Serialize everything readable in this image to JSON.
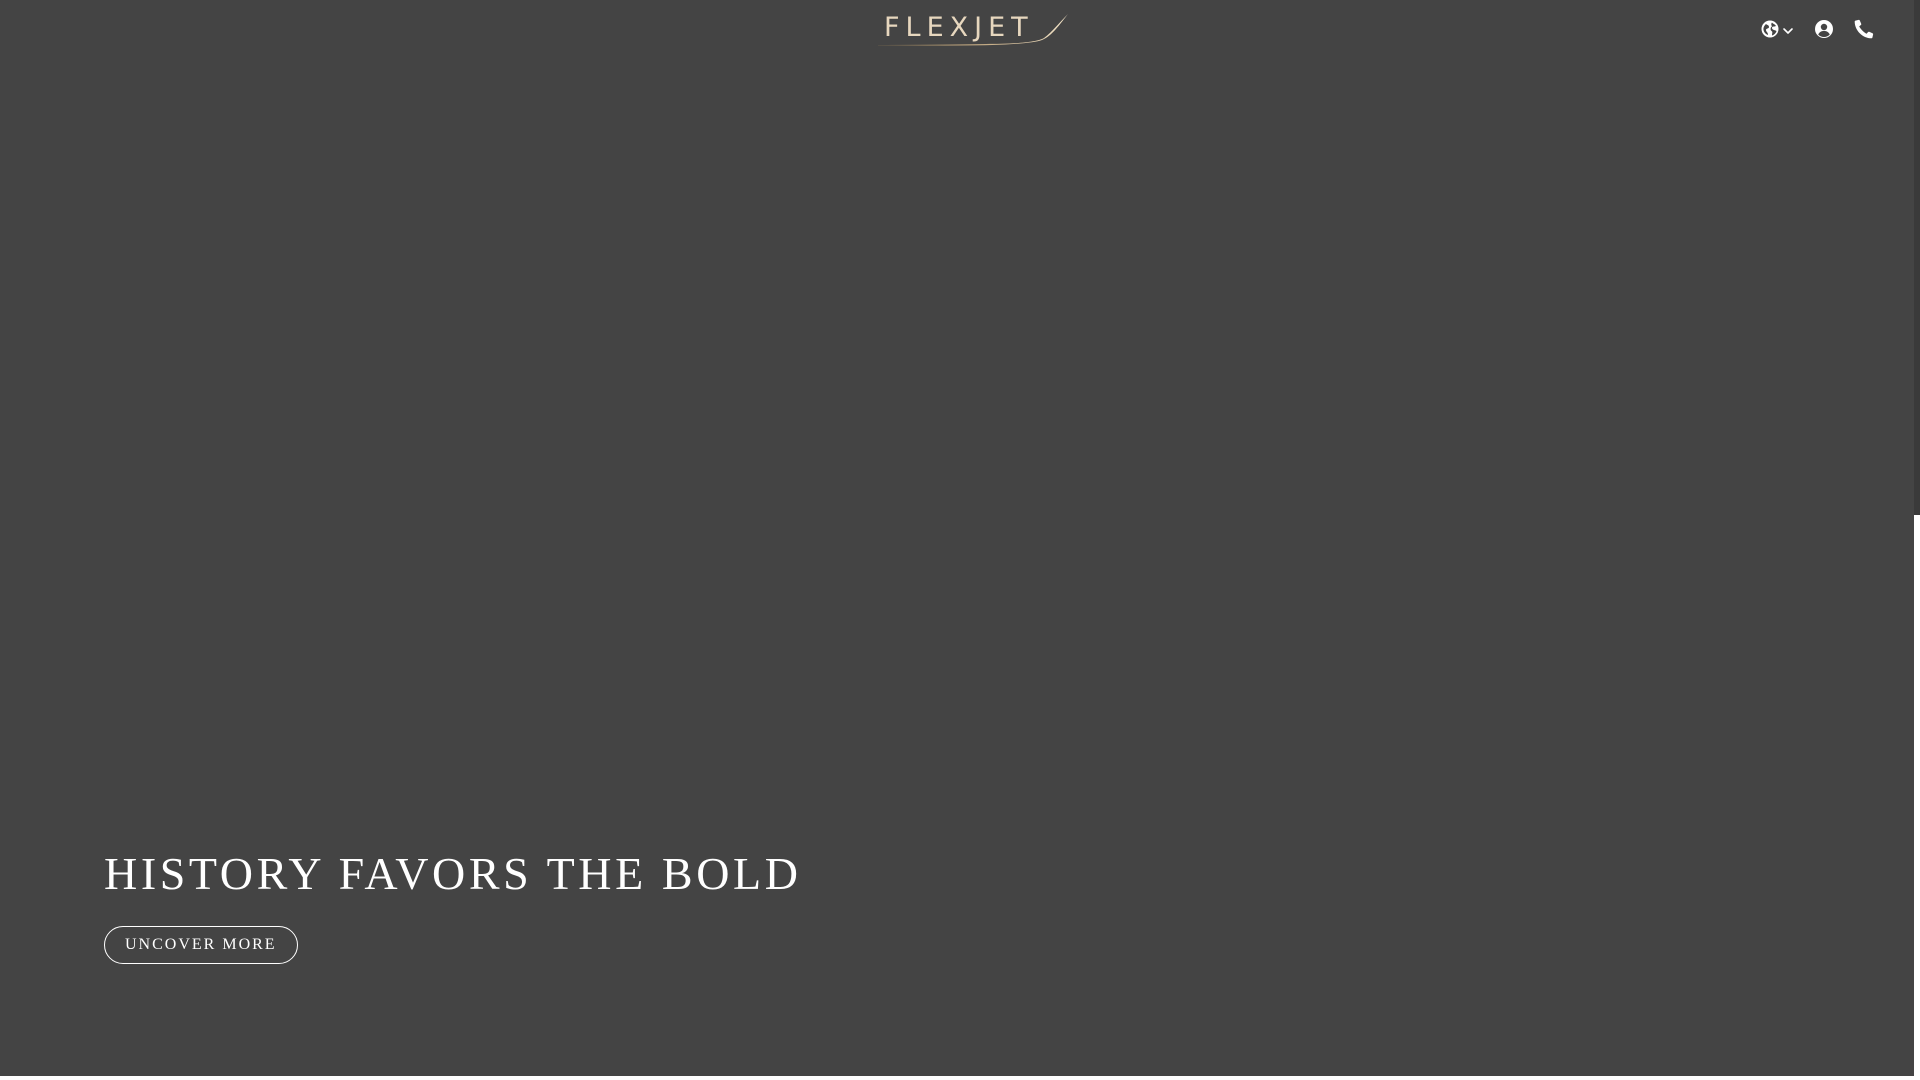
{
  "header": {
    "logo_text": "FLEXJET",
    "brand_color": "#e7d7be",
    "icons": {
      "language": "globe-icon",
      "dropdown": "chevron-down-icon",
      "account": "user-circle-icon",
      "phone": "phone-icon"
    }
  },
  "hero": {
    "title": "HISTORY FAVORS THE BOLD",
    "cta_label": "UNCOVER MORE",
    "background_color": "#444444"
  }
}
